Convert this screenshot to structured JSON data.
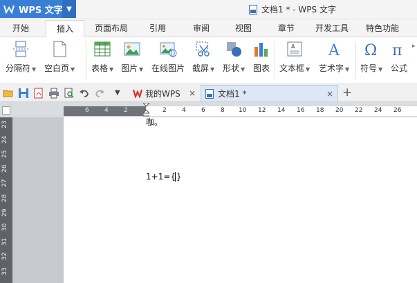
{
  "titlebar": {
    "app_name": "WPS 文字",
    "doc_title": "文档1 * - WPS 文字",
    "accent_color": "#3a7fd6"
  },
  "menu": {
    "tabs": [
      {
        "label": "开始"
      },
      {
        "label": "插入",
        "active": true
      },
      {
        "label": "页面布局"
      },
      {
        "label": "引用"
      },
      {
        "label": "审阅"
      },
      {
        "label": "视图"
      },
      {
        "label": "章节"
      },
      {
        "label": "开发工具"
      },
      {
        "label": "特色功能"
      }
    ]
  },
  "ribbon": {
    "buttons": [
      {
        "label": "分隔符",
        "icon": "page-break-icon",
        "dropdown": true
      },
      {
        "label": "空白页",
        "icon": "blank-page-icon",
        "dropdown": true
      },
      {
        "label": "表格",
        "icon": "table-icon",
        "dropdown": true
      },
      {
        "label": "图片",
        "icon": "picture-icon",
        "dropdown": true
      },
      {
        "label": "在线图片",
        "icon": "online-picture-icon",
        "dropdown": false
      },
      {
        "label": "截屏",
        "icon": "screenshot-icon",
        "dropdown": true
      },
      {
        "label": "形状",
        "icon": "shapes-icon",
        "dropdown": true
      },
      {
        "label": "图表",
        "icon": "chart-icon",
        "dropdown": false
      },
      {
        "label": "文本框",
        "icon": "textbox-icon",
        "dropdown": true
      },
      {
        "label": "艺术字",
        "icon": "wordart-icon",
        "dropdown": true
      },
      {
        "label": "符号",
        "icon": "omega-symbol-icon",
        "dropdown": true
      },
      {
        "label": "公式",
        "icon": "pi-formula-icon",
        "dropdown": false
      }
    ]
  },
  "quickbar": {
    "tabs": [
      {
        "label": "我的WPS",
        "icon": "wps-logo-icon",
        "close": "×"
      },
      {
        "label": "文档1 *",
        "icon": "document-icon",
        "close": "×",
        "active": true
      }
    ],
    "new_tab": "+"
  },
  "ruler": {
    "ticks": [
      "6",
      "4",
      "2",
      "2",
      "4",
      "6",
      "8",
      "10",
      "12",
      "14",
      "16",
      "18",
      "20",
      "22",
      "24",
      "26"
    ],
    "vertical": [
      "23",
      "24",
      "25",
      "26",
      "27",
      "28",
      "29",
      "30",
      "31",
      "32",
      "33"
    ]
  },
  "document": {
    "line1": "咖。",
    "formula": "1+1={ ",
    "formula_end": " }"
  }
}
